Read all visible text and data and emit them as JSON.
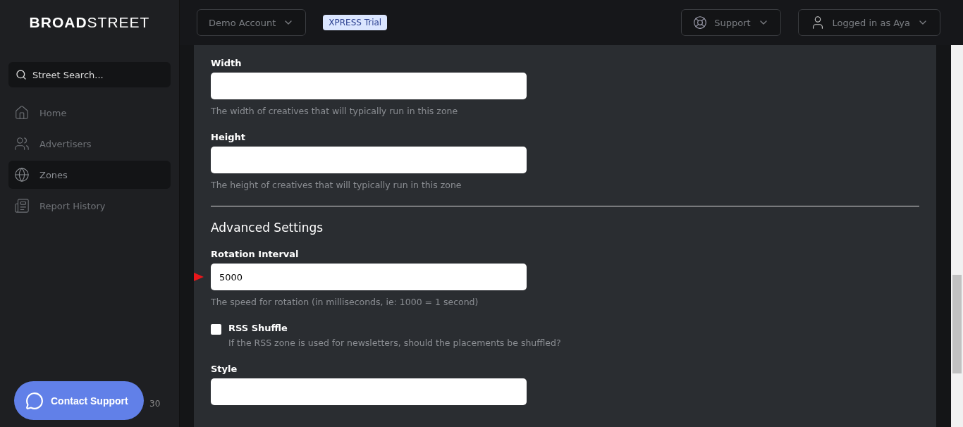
{
  "sidebar": {
    "logo": {
      "bold": "BROAD",
      "light": "STREET"
    },
    "search": {
      "placeholder": "Street Search..."
    },
    "items": [
      {
        "kind": "home",
        "label": "Home",
        "selected": false
      },
      {
        "kind": "people",
        "label": "Advertisers",
        "selected": false
      },
      {
        "kind": "globe",
        "label": "Zones",
        "selected": true
      },
      {
        "kind": "report",
        "label": "Report History",
        "selected": false
      }
    ],
    "footer_text": "30",
    "contact_button": "Contact Support"
  },
  "topbar": {
    "account": "Demo Account",
    "badge": "XPRESS Trial",
    "support": "Support",
    "user": "Logged in as Aya"
  },
  "form": {
    "fields": [
      {
        "kind": "text",
        "label": "Width",
        "help": "The width of creatives that will typically run in this zone"
      },
      {
        "kind": "text",
        "label": "Height",
        "help": "The height of creatives that will typically run in this zone"
      },
      {
        "kind": "divider"
      },
      {
        "kind": "heading",
        "label": "Advanced Settings"
      },
      {
        "kind": "text",
        "label": "Rotation Interval",
        "value": "5000",
        "help": "The speed for rotation (in milliseconds, ie: 1000 = 1 second)",
        "pointer": true
      },
      {
        "kind": "checkbox",
        "label": "RSS Shuffle",
        "checked": false,
        "help": "If the RSS zone is used for newsletters, should the placements be shuffled?"
      },
      {
        "kind": "text",
        "label": "Style"
      }
    ]
  }
}
